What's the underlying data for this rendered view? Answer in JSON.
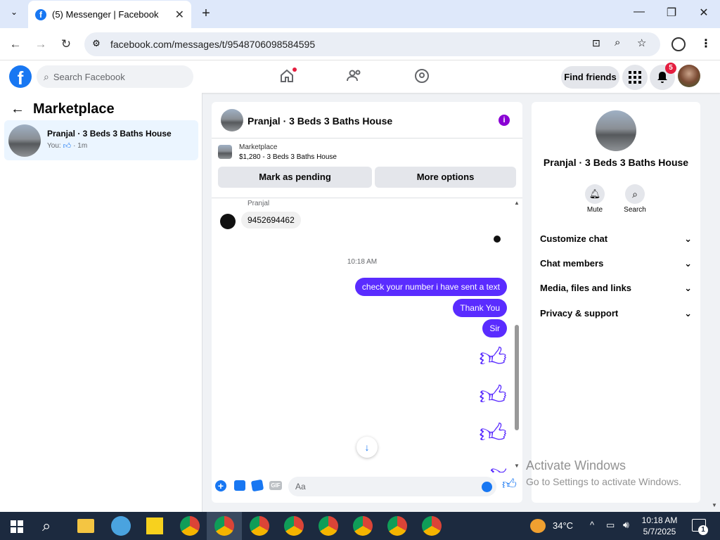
{
  "browser": {
    "tab_title": "(5) Messenger | Facebook",
    "url": "facebook.com/messages/t/9548706098584595"
  },
  "fb": {
    "search_placeholder": "Search Facebook",
    "find_friends": "Find friends",
    "notification_count": "5"
  },
  "left": {
    "title": "Marketplace",
    "conversation": {
      "name": "Pranjal · 3 Beds 3 Baths House",
      "preview_prefix": "You:",
      "preview_suffix": "· 1m"
    }
  },
  "chat": {
    "title": "Pranjal · 3 Beds 3 Baths House",
    "marketplace_label": "Marketplace",
    "listing": "$1,280 - 3 Beds 3 Baths House",
    "mark_pending": "Mark as pending",
    "more_options": "More options",
    "sender_name": "Pranjal",
    "incoming_message": "9452694462",
    "timestamp": "10:18 AM",
    "outgoing": [
      "check your number i have sent a text",
      "Thank You",
      "Sir"
    ],
    "composer_placeholder": "Aa"
  },
  "right": {
    "name": "Pranjal · 3 Beds 3 Baths House",
    "mute": "Mute",
    "search": "Search",
    "sections": [
      "Customize chat",
      "Chat members",
      "Media, files and links",
      "Privacy & support"
    ]
  },
  "watermark": {
    "line1": "Activate Windows",
    "line2": "Go to Settings to activate Windows."
  },
  "taskbar": {
    "temperature": "34°C",
    "time": "10:18 AM",
    "date": "5/7/2025",
    "notif": "1"
  },
  "colors": {
    "fb_blue": "#1877f2",
    "messenger_purple": "#5a2cff",
    "taskbar": "#1c2a3f"
  }
}
